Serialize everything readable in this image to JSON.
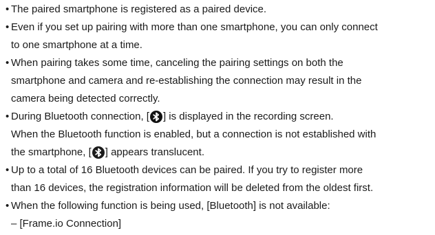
{
  "bullet_glyph": "•",
  "bluetooth_icon": "bluetooth-icon",
  "lines": {
    "l1": "The paired smartphone is registered as a paired device.",
    "l2": "Even if you set up pairing with more than one smartphone, you can only connect",
    "l3": "to one smartphone at a time.",
    "l4": "When pairing takes some time, canceling the pairing settings on both the",
    "l5": "smartphone and camera and re-establishing the connection may result in the",
    "l6": "camera being detected correctly.",
    "l7a": "During Bluetooth connection, [",
    "l7b": "] is displayed in the recording screen.",
    "l8": "When the Bluetooth function is enabled, but a connection is not established with",
    "l9a": "the smartphone, [",
    "l9b": "] appears translucent.",
    "l10": "Up to a total of 16 Bluetooth devices can be paired. If you try to register more",
    "l11": "than 16 devices, the registration information will be deleted from the oldest first.",
    "l12": "When the following function is being used, [Bluetooth] is not available:",
    "l13": "– [Frame.io Connection]"
  }
}
